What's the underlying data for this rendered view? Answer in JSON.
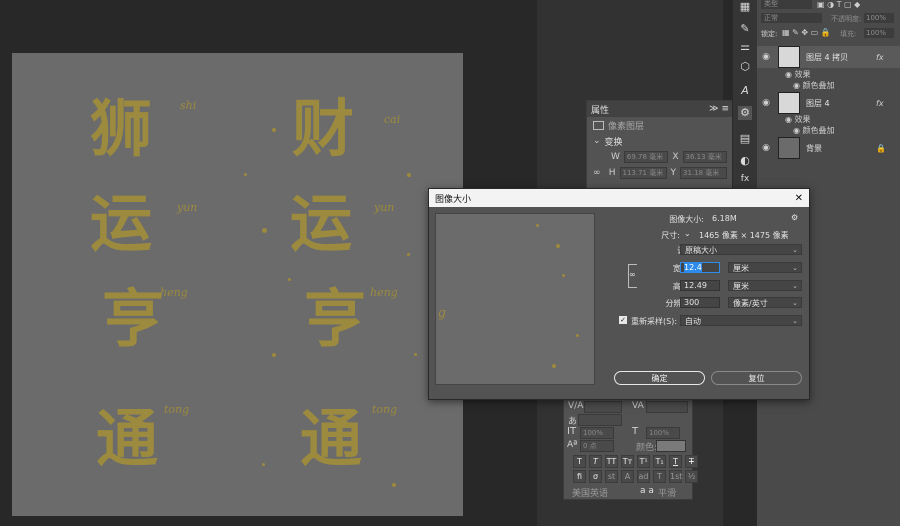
{
  "canvas": {
    "left_column": [
      "狮",
      "运",
      "亨",
      "通"
    ],
    "right_column": [
      "财",
      "运",
      "亨",
      "通"
    ],
    "pinyin_left": [
      "shi",
      "yun",
      "heng",
      "tong"
    ],
    "pinyin_right": [
      "cai",
      "yun",
      "heng",
      "tong"
    ],
    "glyph_color": "#9c8a3e"
  },
  "properties_panel": {
    "title": "属性",
    "subtitle": "像素图层",
    "section": "变换",
    "w_label": "W",
    "w_value": "69.78 毫米",
    "x_label": "X",
    "x_value": "36.13 毫米",
    "h_label": "H",
    "h_value": "113.71 毫米",
    "y_label": "Y",
    "y_value": "31.18 毫米"
  },
  "layers_panel": {
    "search_placeholder": "类型",
    "mode": "正常",
    "opacity_label": "不透明度:",
    "opacity_value": "100%",
    "lock_label": "锁定:",
    "fill_label": "填充:",
    "fill_value": "100%",
    "layers": [
      {
        "name": "图层 4 拷贝",
        "fx": "fx"
      },
      {
        "name": "图层 4",
        "fx": "fx"
      },
      {
        "name": "背景",
        "fx": ""
      }
    ],
    "effects_label": "效果",
    "effect_item": "颜色叠加"
  },
  "dialog": {
    "title": "图像大小",
    "close": "✕",
    "image_size_label": "图像大小:",
    "image_size_value": "6.18M",
    "dimensions_label": "尺寸:",
    "dimensions_value": "1465 像素  ×  1475 像素",
    "fit_to_label": "调整为:",
    "fit_to_value": "原稿大小",
    "width_label": "宽度(D):",
    "width_value": "12.4",
    "width_unit": "厘米",
    "height_label": "高度(G):",
    "height_value": "12.49",
    "height_unit": "厘米",
    "resolution_label": "分辨率(R):",
    "resolution_value": "300",
    "resolution_unit": "像素/英寸",
    "resample_label": "重新采样(S):",
    "resample_value": "自动",
    "ok_label": "确定",
    "cancel_label": "复位",
    "accent": "#2d8ceb"
  },
  "character_panel": {
    "color_label": "颜色:",
    "size_a": "100%",
    "size_b": "100%",
    "baseline": "0 点",
    "language": "美国英语",
    "aa_label": "a a",
    "aa_value": "平滑"
  }
}
